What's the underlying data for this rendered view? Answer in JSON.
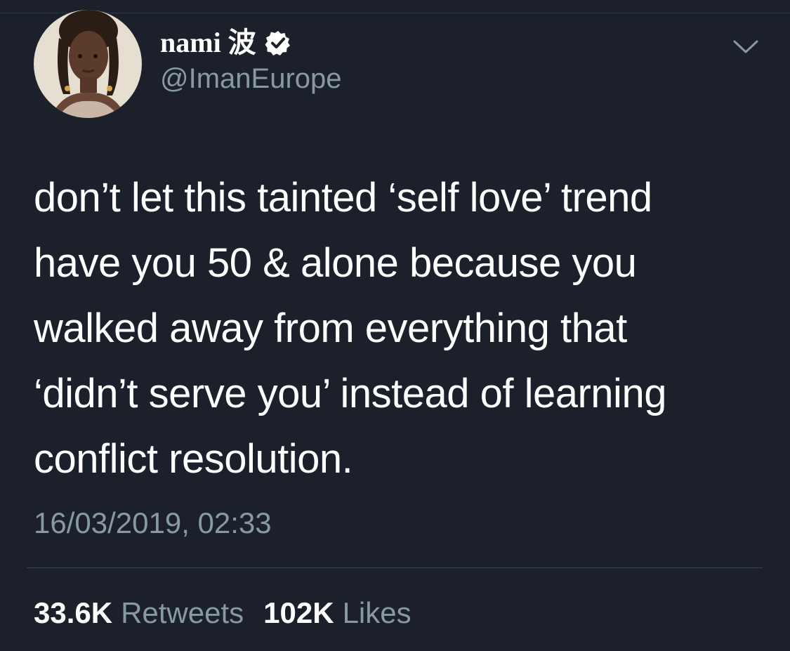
{
  "profile": {
    "display_name": "nami 波",
    "handle": "@ImanEurope",
    "avatar_icon": "profile-photo",
    "verified_icon": "verified-badge-icon",
    "menu_icon": "chevron-down-icon"
  },
  "tweet": {
    "lines": [
      "don’t let this tainted ‘self love’ trend",
      "have you 50 & alone because you",
      "walked away from everything that",
      "‘didn’t serve you’ instead of learning",
      "conflict resolution."
    ],
    "timestamp": "16/03/2019, 02:33"
  },
  "stats": {
    "retweets_count": "33.6K",
    "retweets_label": "Retweets",
    "likes_count": "102K",
    "likes_label": "Likes"
  },
  "colors": {
    "background": "#1b202b",
    "text_primary": "#ffffff",
    "text_secondary": "#8899a6",
    "divider": "#3a4350"
  }
}
